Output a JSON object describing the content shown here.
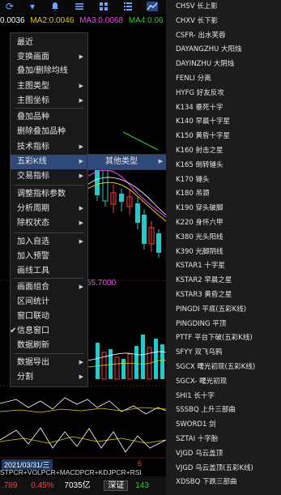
{
  "toolbar": {
    "icons": [
      "refresh-icon",
      "dropdown-icon",
      "bell-icon",
      "list-icon",
      "grid-icon",
      "menu-icon",
      "chart-icon"
    ]
  },
  "ma": {
    "first": "0.0036",
    "ma2": "MA2:0.0046",
    "ma3": "MA3:0.0068",
    "ma4": "MA4:0.06"
  },
  "chart": {
    "price_label": "55.7000",
    "date_label": "2021/03/31/三",
    "date_suffix": "6",
    "indicator_label": "STPCR+VOLPCR+MACDPCR+KDJPCR+RSI"
  },
  "menu": {
    "items": [
      {
        "label": "最近"
      },
      {
        "label": "变换画面",
        "arrow": true
      },
      {
        "label": "叠加/删除均线"
      },
      {
        "label": "主图类型",
        "arrow": true
      },
      {
        "label": "主图坐标",
        "arrow": true
      },
      {
        "label": "叠加品种"
      },
      {
        "label": "删除叠加品种"
      },
      {
        "label": "技术指标",
        "arrow": true
      },
      {
        "label": "五彩K线",
        "arrow": true,
        "selected": true
      },
      {
        "label": "交易指标",
        "arrow": true
      },
      {
        "label": "调整指标参数"
      },
      {
        "label": "分析周期",
        "arrow": true
      },
      {
        "label": "除权状态",
        "arrow": true
      },
      {
        "label": "加入自选",
        "arrow": true
      },
      {
        "label": "加入预警"
      },
      {
        "label": "画线工具"
      },
      {
        "label": "画面组合",
        "arrow": true
      },
      {
        "label": "区间统计"
      },
      {
        "label": "窗口联动"
      },
      {
        "label": "信息窗口",
        "checked": true
      },
      {
        "label": "数据刷新"
      },
      {
        "label": "数据导出",
        "arrow": true
      },
      {
        "label": "分割",
        "arrow": true
      }
    ],
    "arrow_glyph": "▶",
    "check_glyph": "✔"
  },
  "submenu": {
    "label": "其他类型",
    "arrow_glyph": "▶"
  },
  "patterns": [
    "CHSV 长上影",
    "CHXV 长下影",
    "CSFR- 出水芙蓉",
    "DAYANGZHU 大阳烛",
    "DAYINZHU 大阴烛",
    "FENLI 分离",
    "HYFG 好友反攻",
    "K134 垂死十字",
    "K140 早晨十字星",
    "K150 黄昏十字星",
    "K160 射击之星",
    "K165 倒转锤头",
    "K170 锤头",
    "K180 吊颈",
    "K190 穿头破脚",
    "K220 身怀六甲",
    "K380 光头阳线",
    "K390 光脚阴线",
    "KSTAR1 十字星",
    "KSTAR2 早晨之星",
    "KSTAR3 黄昏之星",
    "PINGDI 平底(五彩K线)",
    "PINGDING 平顶",
    "PTTF 平台下破(五彩K线)",
    "SFYY 双飞乌鸦",
    "SGCX 曙光初现(五彩K线)",
    "SGCX- 曙光初现",
    "SHI1 长十字",
    "SSSBQ 上升三部曲",
    "SWORD1 剑",
    "SZTAI 十字胎",
    "VJGD 乌云盖顶",
    "VJGD 乌云盖顶(五彩K线)",
    "XDSBQ 下跌三部曲"
  ],
  "bottom": {
    "v1": ".789",
    "v2": "0.45%",
    "v3": "7035亿",
    "button": "深证",
    "v4": "143"
  },
  "colors": {
    "up": "#ff3b3b",
    "down": "#28c8c8",
    "yellow": "#e8d000",
    "magenta": "#ff40ff",
    "green": "#2bd12b",
    "menu_selected": "#2f4a7a"
  }
}
